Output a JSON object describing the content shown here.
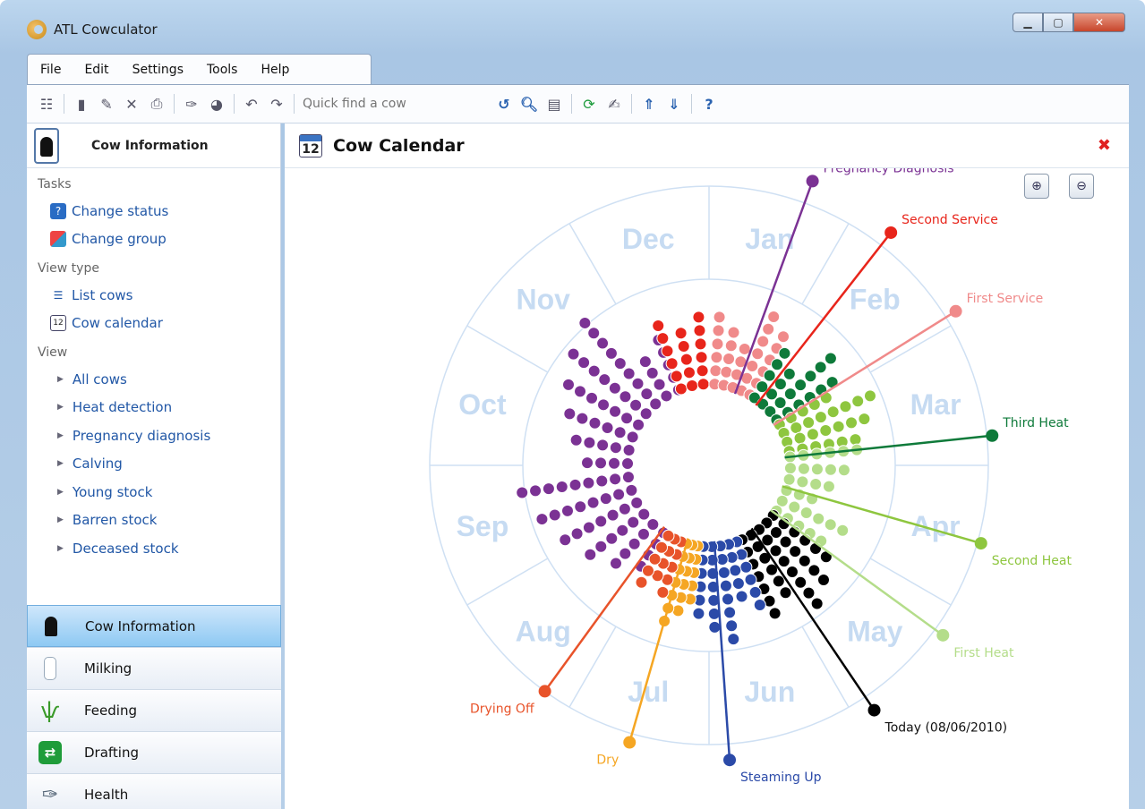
{
  "window": {
    "title": "ATL Cowculator"
  },
  "menu": [
    "File",
    "Edit",
    "Settings",
    "Tools",
    "Help"
  ],
  "toolbar": {
    "quickfind_placeholder": "Quick find a cow"
  },
  "left_panel": {
    "header": "Cow Information",
    "tasks_heading": "Tasks",
    "tasks": [
      {
        "label": "Change status",
        "icon": "question-icon"
      },
      {
        "label": "Change group",
        "icon": "group-icon"
      }
    ],
    "view_type_heading": "View type",
    "view_types": [
      {
        "label": "List cows",
        "icon": "list-icon"
      },
      {
        "label": "Cow calendar",
        "icon": "calendar-icon"
      }
    ],
    "view_heading": "View",
    "views": [
      "All cows",
      "Heat detection",
      "Pregnancy diagnosis",
      "Calving",
      "Young stock",
      "Barren stock",
      "Deceased stock"
    ],
    "nav": [
      "Cow Information",
      "Milking",
      "Feeding",
      "Drafting",
      "Health"
    ]
  },
  "main": {
    "title": "Cow Calendar",
    "months": [
      "Jan",
      "Feb",
      "Mar",
      "Apr",
      "May",
      "Jun",
      "Jul",
      "Aug",
      "Sep",
      "Oct",
      "Nov",
      "Dec"
    ]
  },
  "chart_data": {
    "type": "radial-calendar",
    "categories": [
      {
        "name": "Pregnancy Diagnosis",
        "color": "#7b3294"
      },
      {
        "name": "Second Service",
        "color": "#e8251b"
      },
      {
        "name": "First Service",
        "color": "#f08a8a"
      },
      {
        "name": "Third Heat",
        "color": "#0e7a3a"
      },
      {
        "name": "Second Heat",
        "color": "#8ec63f"
      },
      {
        "name": "First Heat",
        "color": "#b4dd8a"
      },
      {
        "name": "Today (08/06/2010)",
        "color": "#000000"
      },
      {
        "name": "Steaming Up",
        "color": "#2b4aa8"
      },
      {
        "name": "Dry",
        "color": "#f5a623"
      },
      {
        "name": "Drying Off",
        "color": "#e8532a"
      }
    ]
  }
}
